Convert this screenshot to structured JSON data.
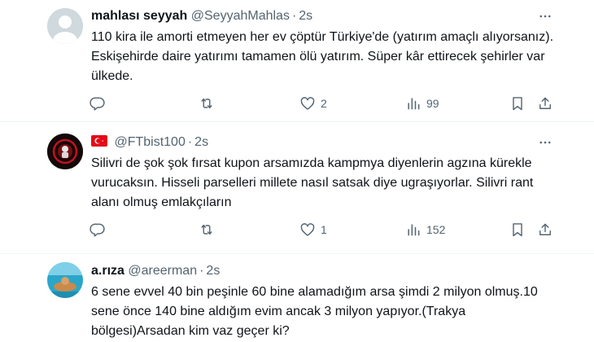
{
  "tweets": [
    {
      "name": "mahlası seyyah",
      "handle": "@SeyyahMahlas",
      "separator": "·",
      "time": "2s",
      "text": "110 kira ile amorti etmeyen her ev çöptür Türkiye'de (yatırım amaçlı alıyorsanız). Eskişehirde daire yatırımı tamamen ölü yatırım. Süper kâr ettirecek şehirler var ülkede.",
      "likes": "2",
      "views": "99"
    },
    {
      "name": "",
      "flag": "turkey-flag-icon",
      "handle": "@FTbist100",
      "separator": "·",
      "time": "2s",
      "text": "Silivri de şok şok fırsat kupon arsamızda kampmya diyenlerin agzına kürekle vurucaksın. Hisseli parselleri millete nasıl satsak diye ugraşıyorlar. Silivri rant alanı olmuş emlakçıların",
      "likes": "1",
      "views": "152"
    },
    {
      "name": "a.rıza",
      "handle": "@areerman",
      "separator": "·",
      "time": "2s",
      "text": "6 sene evvel 40 bin peşinle 60 bine alamadığım arsa şimdi 2 milyon olmuş.10 sene önce 140 bine aldığım evim ancak 3 milyon yapıyor.(Trakya bölgesi)Arsadan kim vaz geçer ki?"
    }
  ],
  "icons": {
    "reply": "reply-icon",
    "retweet": "retweet-icon",
    "like": "heart-icon",
    "views": "views-icon",
    "bookmark": "bookmark-icon",
    "share": "share-icon",
    "more": "more-icon"
  },
  "colors": {
    "text": "#0f1419",
    "secondary": "#536471",
    "divider": "#eff3f4",
    "flag": "#e30a17"
  }
}
